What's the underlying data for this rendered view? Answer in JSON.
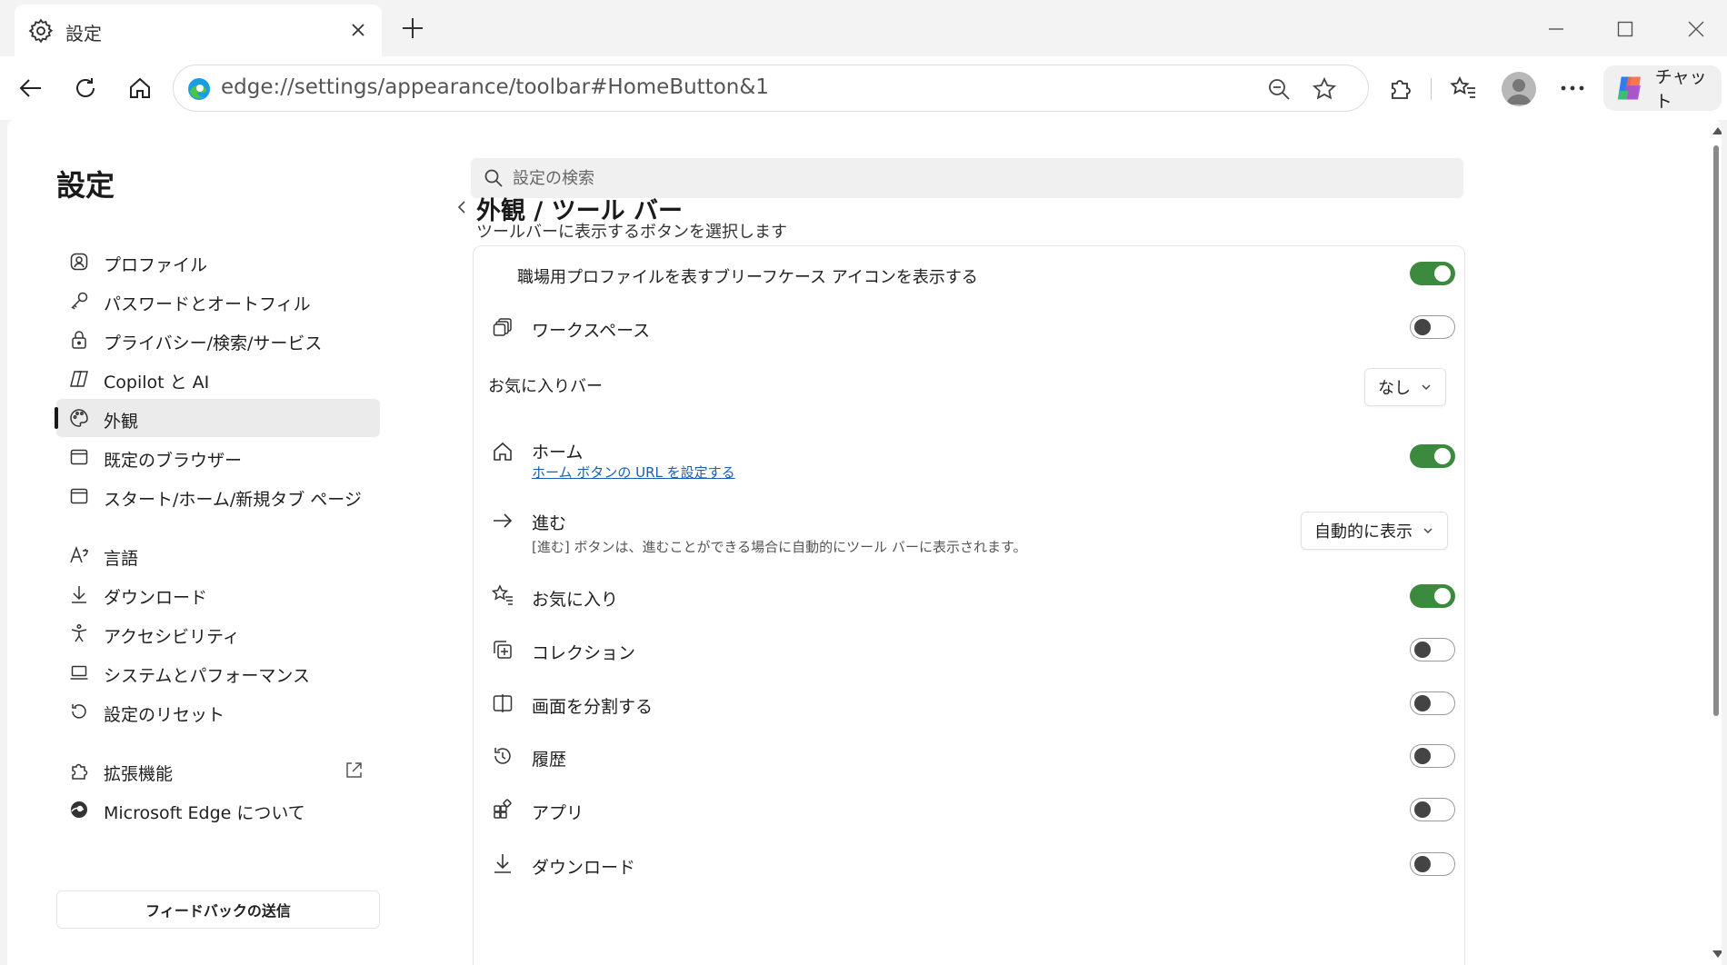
{
  "tab": {
    "title": "設定"
  },
  "address": {
    "url": "edge://settings/appearance/toolbar#HomeButton&1"
  },
  "toolbar": {
    "copilot_label": "チャット"
  },
  "sidebar": {
    "title": "設定",
    "items": [
      {
        "label": "プロファイル"
      },
      {
        "label": "パスワードとオートフィル"
      },
      {
        "label": "プライバシー/検索/サービス"
      },
      {
        "label": "Copilot と AI"
      },
      {
        "label": "外観"
      },
      {
        "label": "既定のブラウザー"
      },
      {
        "label": "スタート/ホーム/新規タブ ページ"
      },
      {
        "label": "言語"
      },
      {
        "label": "ダウンロード"
      },
      {
        "label": "アクセシビリティ"
      },
      {
        "label": "システムとパフォーマンス"
      },
      {
        "label": "設定のリセット"
      },
      {
        "label": "拡張機能"
      },
      {
        "label": "Microsoft Edge について"
      }
    ],
    "active_index": 4,
    "feedback_label": "フィードバックの送信"
  },
  "search": {
    "placeholder": "設定の検索"
  },
  "main": {
    "breadcrumb": "外観 / ツール バー",
    "subtitle": "ツールバーに表示するボタンを選択します",
    "rows": {
      "work_profile": {
        "label": "職場用プロファイルを表すブリーフケース アイコンを表示する",
        "on": true
      },
      "workspaces": {
        "label": "ワークスペース",
        "on": false
      },
      "favorites_bar": {
        "label": "お気に入りバー",
        "value": "なし"
      },
      "home": {
        "label": "ホーム",
        "link": "ホーム ボタンの URL を設定する",
        "on": true
      },
      "forward": {
        "label": "進む",
        "desc": "[進む] ボタンは、進むことができる場合に自動的にツール バーに表示されます。",
        "value": "自動的に表示"
      },
      "favorites": {
        "label": "お気に入り",
        "on": true
      },
      "collections": {
        "label": "コレクション",
        "on": false
      },
      "split_screen": {
        "label": "画面を分割する",
        "on": false
      },
      "history": {
        "label": "履歴",
        "on": false
      },
      "apps": {
        "label": "アプリ",
        "on": false
      },
      "downloads": {
        "label": "ダウンロード",
        "on": false
      }
    }
  },
  "colors": {
    "toggle_on": "#3b8a3e",
    "link": "#1a5fb4",
    "accent_active": "#1a1a1a"
  }
}
